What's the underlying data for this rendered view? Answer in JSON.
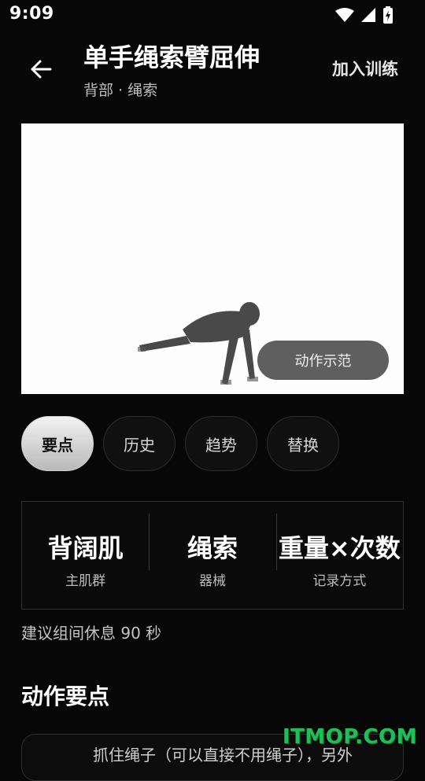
{
  "status_bar": {
    "time": "9:09"
  },
  "header": {
    "title": "单手绳索臂屈伸",
    "subtitle": "背部 · 绳索",
    "add_button": "加入训练"
  },
  "video": {
    "demo_button": "动作示范"
  },
  "tabs": [
    {
      "label": "要点",
      "active": true
    },
    {
      "label": "历史"
    },
    {
      "label": "趋势"
    },
    {
      "label": "替换"
    }
  ],
  "info": [
    {
      "value": "背阔肌",
      "label": "主肌群"
    },
    {
      "value": "绳索",
      "label": "器械"
    },
    {
      "value": "重量×次数",
      "label": "记录方式"
    }
  ],
  "rest_tip": "建议组间休息 90 秒",
  "section_title": "动作要点",
  "tips": {
    "first": "抓住绳子（可以直接不用绳子），另外"
  },
  "watermark": "ITMOP.COM"
}
